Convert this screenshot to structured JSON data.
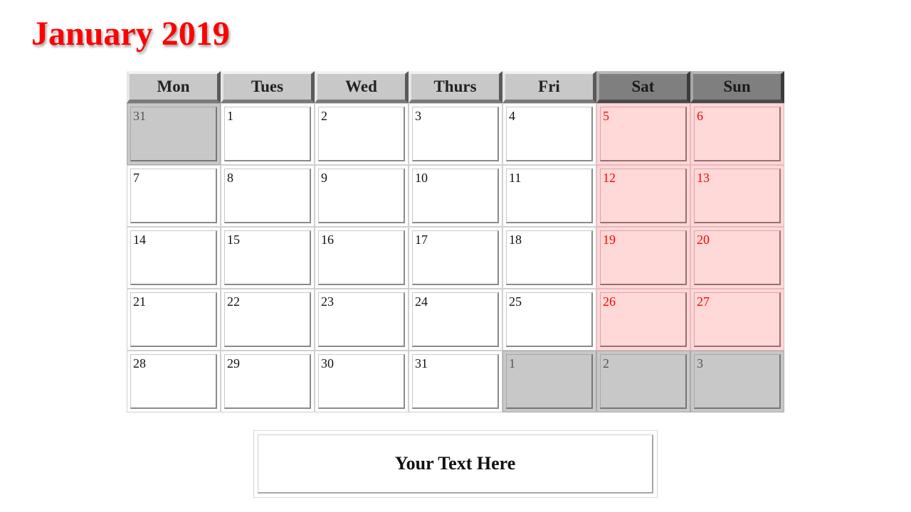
{
  "title": "January 2019",
  "colors": {
    "title": "#ff0000",
    "weekend_bg": "#ffd8d8",
    "weekend_text": "#ff0000",
    "other_month_bg": "#c8c8c8"
  },
  "headers": [
    {
      "label": "Mon",
      "style": "light"
    },
    {
      "label": "Tues",
      "style": "light"
    },
    {
      "label": "Wed",
      "style": "light"
    },
    {
      "label": "Thurs",
      "style": "light"
    },
    {
      "label": "Fri",
      "style": "light"
    },
    {
      "label": "Sat",
      "style": "dark"
    },
    {
      "label": "Sun",
      "style": "dark"
    }
  ],
  "weeks": [
    [
      {
        "d": "31",
        "t": "other"
      },
      {
        "d": "1",
        "t": "white"
      },
      {
        "d": "2",
        "t": "white"
      },
      {
        "d": "3",
        "t": "white"
      },
      {
        "d": "4",
        "t": "white"
      },
      {
        "d": "5",
        "t": "weekend"
      },
      {
        "d": "6",
        "t": "weekend"
      }
    ],
    [
      {
        "d": "7",
        "t": "white"
      },
      {
        "d": "8",
        "t": "white"
      },
      {
        "d": "9",
        "t": "white"
      },
      {
        "d": "10",
        "t": "white"
      },
      {
        "d": "11",
        "t": "white"
      },
      {
        "d": "12",
        "t": "weekend"
      },
      {
        "d": "13",
        "t": "weekend"
      }
    ],
    [
      {
        "d": "14",
        "t": "white"
      },
      {
        "d": "15",
        "t": "white"
      },
      {
        "d": "16",
        "t": "white"
      },
      {
        "d": "17",
        "t": "white"
      },
      {
        "d": "18",
        "t": "white"
      },
      {
        "d": "19",
        "t": "weekend"
      },
      {
        "d": "20",
        "t": "weekend"
      }
    ],
    [
      {
        "d": "21",
        "t": "white"
      },
      {
        "d": "22",
        "t": "white"
      },
      {
        "d": "23",
        "t": "white"
      },
      {
        "d": "24",
        "t": "white"
      },
      {
        "d": "25",
        "t": "white"
      },
      {
        "d": "26",
        "t": "weekend"
      },
      {
        "d": "27",
        "t": "weekend"
      }
    ],
    [
      {
        "d": "28",
        "t": "white"
      },
      {
        "d": "29",
        "t": "white"
      },
      {
        "d": "30",
        "t": "white"
      },
      {
        "d": "31",
        "t": "white"
      },
      {
        "d": "1",
        "t": "other"
      },
      {
        "d": "2",
        "t": "other"
      },
      {
        "d": "3",
        "t": "other"
      }
    ]
  ],
  "note": {
    "text": "Your Text Here"
  }
}
